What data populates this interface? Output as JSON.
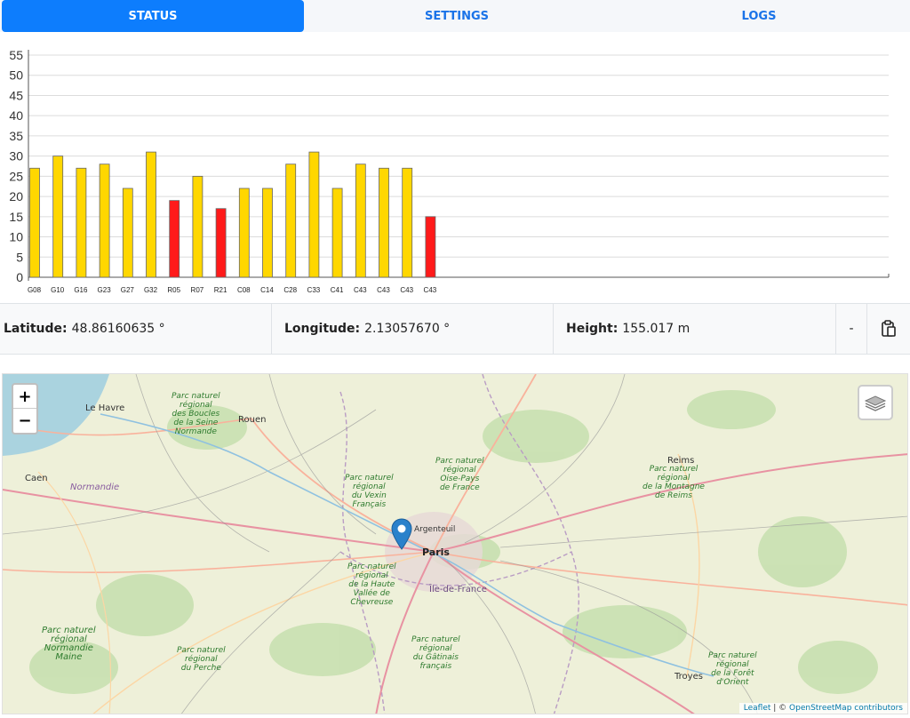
{
  "tabs": [
    {
      "label": "STATUS",
      "active": true
    },
    {
      "label": "SETTINGS",
      "active": false
    },
    {
      "label": "LOGS",
      "active": false
    }
  ],
  "chart_data": {
    "type": "bar",
    "categories": [
      "G08",
      "G10",
      "G16",
      "G23",
      "G27",
      "G32",
      "R05",
      "R07",
      "R21",
      "C08",
      "C14",
      "C28",
      "C33",
      "C41",
      "C43",
      "C43",
      "C43",
      "C43"
    ],
    "values": [
      27,
      30,
      27,
      28,
      22,
      31,
      19,
      25,
      17,
      22,
      22,
      28,
      31,
      22,
      28,
      27,
      27,
      15
    ],
    "colors": [
      "#ffd700",
      "#ffd700",
      "#ffd700",
      "#ffd700",
      "#ffd700",
      "#ffd700",
      "#ff1a1a",
      "#ffd700",
      "#ff1a1a",
      "#ffd700",
      "#ffd700",
      "#ffd700",
      "#ffd700",
      "#ffd700",
      "#ffd700",
      "#ffd700",
      "#ffd700",
      "#ff1a1a"
    ],
    "yticks": [
      "0",
      "5",
      "10",
      "15",
      "20",
      "25",
      "30",
      "35",
      "40",
      "45",
      "50",
      "55"
    ],
    "ylim": [
      0,
      55
    ],
    "grid": true
  },
  "position": {
    "latitude_label": "Latitude:",
    "latitude_value": "48.86160635 °",
    "longitude_label": "Longitude:",
    "longitude_value": "2.13057670 °",
    "height_label": "Height:",
    "height_value": "155.017 m",
    "dash": "-",
    "copy_icon": "clipboard-icon"
  },
  "map": {
    "zoom_in": "+",
    "zoom_out": "−",
    "layers_icon": "layers-icon",
    "marker_icon": "map-marker-icon",
    "attribution_leaflet": "Leaflet",
    "attribution_sep": " | © ",
    "attribution_osm": "OpenStreetMap contributors",
    "cities": [
      {
        "name": "Le Havre"
      },
      {
        "name": "Rouen"
      },
      {
        "name": "Caen"
      },
      {
        "name": "Paris"
      },
      {
        "name": "Reims"
      },
      {
        "name": "Troyes"
      },
      {
        "name": "Île-de-France"
      },
      {
        "name": "Argenteuil"
      }
    ],
    "regions": [
      {
        "name": "Normandie"
      },
      {
        "name": "Parc naturel\nrégional\ndes Boucles\nde la Seine\nNormande"
      },
      {
        "name": "Parc naturel\nrégional\nOise-Pays\nde France"
      },
      {
        "name": "Parc naturel\nrégional\ndu Vexin\nFrançais"
      },
      {
        "name": "Parc naturel\nrégional\nde la Montagne\nde Reims"
      },
      {
        "name": "Parc naturel\nrégional\nde la Haute\nVallée de\nChevreuse"
      },
      {
        "name": "Parc naturel\nrégional\nNormandie\nMaine"
      },
      {
        "name": "Parc naturel\nrégional\ndu Perche"
      },
      {
        "name": "Parc naturel\nrégional\ndu Gâtinais\nfrançais"
      },
      {
        "name": "Parc naturel\nrégional\nde la Forêt\nd'Orient"
      }
    ]
  }
}
